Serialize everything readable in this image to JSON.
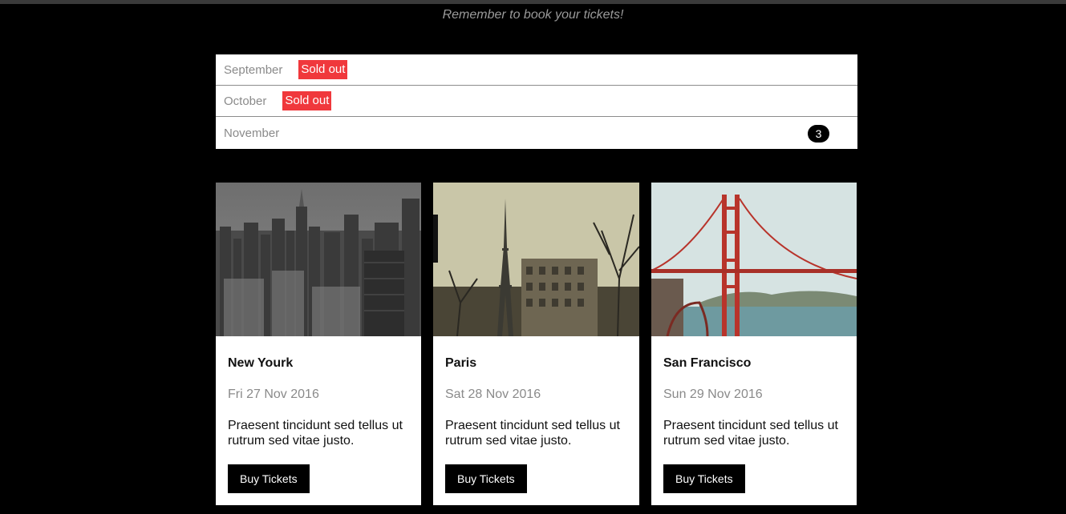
{
  "header": {
    "reminder": "Remember to book your tickets!"
  },
  "months": [
    {
      "name": "September",
      "badge": "Sold out"
    },
    {
      "name": "October",
      "badge": "Sold out"
    },
    {
      "name": "November",
      "count": "3"
    }
  ],
  "cards": [
    {
      "title": "New Yourk",
      "date": "Fri 27 Nov 2016",
      "text": "Praesent tincidunt sed tellus ut rutrum sed vitae justo.",
      "button": "Buy Tickets"
    },
    {
      "title": "Paris",
      "date": "Sat 28 Nov 2016",
      "text": "Praesent tincidunt sed tellus ut rutrum sed vitae justo.",
      "button": "Buy Tickets"
    },
    {
      "title": "San Francisco",
      "date": "Sun 29 Nov 2016",
      "text": "Praesent tincidunt sed tellus ut rutrum sed vitae justo.",
      "button": "Buy Tickets"
    }
  ],
  "colors": {
    "background": "#000000",
    "sold_out": "#f0383c",
    "button": "#000000"
  }
}
